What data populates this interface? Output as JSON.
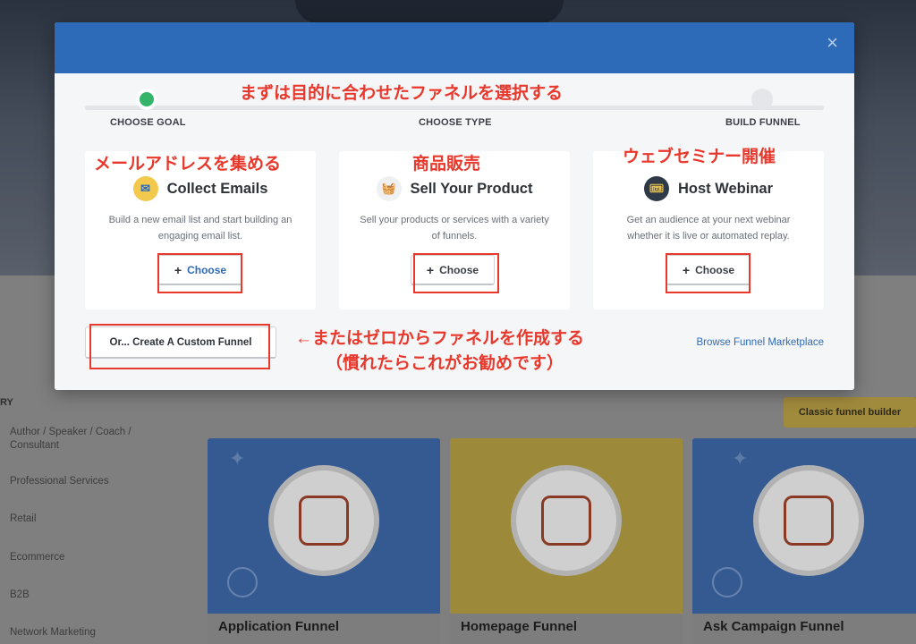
{
  "background": {
    "category_heading": "RY",
    "categories": [
      "Author / Speaker / Coach / Consultant",
      "Professional Services",
      "Retail",
      "Ecommerce",
      "B2B",
      "Network Marketing"
    ],
    "classic_button": "Classic funnel builder",
    "template_cards": [
      {
        "title": "Application Funnel",
        "color": "#355a92"
      },
      {
        "title": "Homepage Funnel",
        "color": "#9c8a3a"
      },
      {
        "title": "Ask Campaign Funnel",
        "color": "#355a92"
      }
    ]
  },
  "modal": {
    "close_label": "×",
    "steps": [
      "CHOOSE GOAL",
      "CHOOSE TYPE",
      "BUILD FUNNEL"
    ],
    "active_step": 0,
    "goals": [
      {
        "title": "Collect Emails",
        "icon": "envelope-icon",
        "icon_glyph": "✉",
        "description": "Build a new email list and start building an engaging email list.",
        "button": "Choose"
      },
      {
        "title": "Sell Your Product",
        "icon": "shopping-basket-icon",
        "icon_glyph": "🧺",
        "description": "Sell your products or services with a variety of funnels.",
        "button": "Choose"
      },
      {
        "title": "Host Webinar",
        "icon": "ticket-icon",
        "icon_glyph": "🎟",
        "description": "Get an audience at your next webinar whether it is live or automated replay.",
        "button": "Choose"
      }
    ],
    "custom_button": "Or... Create A Custom Funnel",
    "marketplace_link": "Browse Funnel Marketplace",
    "button_plus": "+"
  },
  "annotations": {
    "top": "まずは目的に合わせたファネルを選択する",
    "goal1": "メールアドレスを集める",
    "goal2": "商品販売",
    "goal3": "ウェブセミナー開催",
    "custom_line1": "←またはゼロからファネルを作成する",
    "custom_line2": "（慣れたらこれがお勧めです）"
  },
  "colors": {
    "header_blue": "#2d6ab8",
    "annotation_red": "#e8372b",
    "active_step_green": "#35b56a"
  }
}
